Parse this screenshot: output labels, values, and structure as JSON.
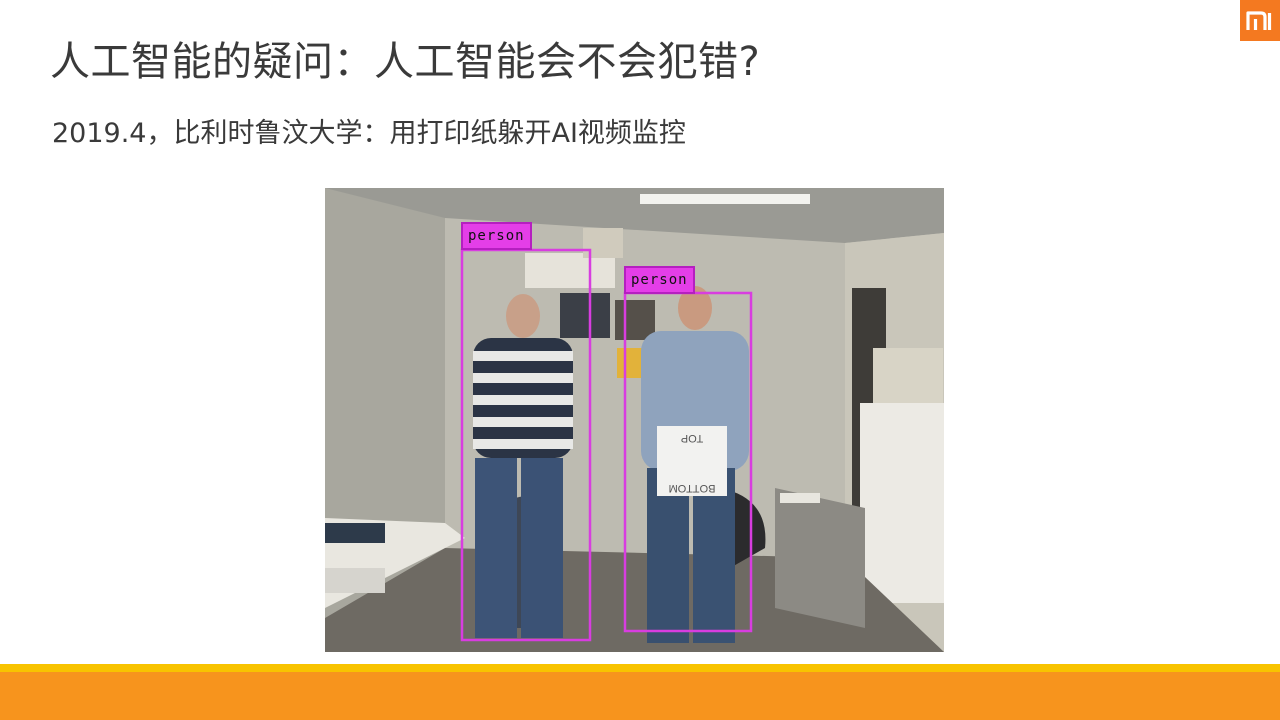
{
  "slide": {
    "logo_icon": "mi-logo-icon",
    "brand_color": "#f47920",
    "title": "人工智能的疑问：人工智能会不会犯错?",
    "subtitle": "2019.4，比利时鲁汶大学：用打印纸躲开AI视频监控"
  },
  "photo": {
    "detections": [
      {
        "label": "person"
      },
      {
        "label": "person"
      }
    ],
    "bag_text_top": "TOP",
    "bag_text_bottom": "BOTTOM"
  },
  "footer": {
    "accent_colors": [
      "#f8c300",
      "#f7941d"
    ]
  }
}
